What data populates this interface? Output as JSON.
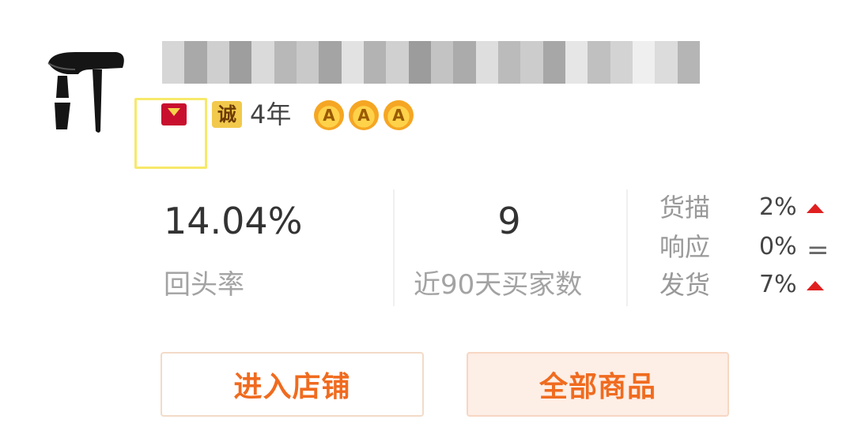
{
  "shop": {
    "logo_icon": "hair-dryer-logo",
    "name": "",
    "name_obscured": true,
    "badges": {
      "tmall_icon": "tmall-badge-icon",
      "cheng_label": "诚",
      "years_label": "4年",
      "crown_count": 3,
      "crown_glyph": "A"
    }
  },
  "stats": {
    "return_rate": {
      "value": "14.04%",
      "label": "回头率"
    },
    "buyers_90d": {
      "value": "9",
      "label": "近90天买家数"
    }
  },
  "ratings": [
    {
      "label": "货描",
      "value": "2%",
      "trend": "up"
    },
    {
      "label": "响应",
      "value": "0%",
      "trend": "equal"
    },
    {
      "label": "发货",
      "value": "7%",
      "trend": "up"
    }
  ],
  "buttons": {
    "enter_shop": "进入店铺",
    "all_products": "全部商品"
  },
  "colors": {
    "accent_orange": "#f06b1f",
    "trend_up_red": "#e02020",
    "badge_gold": "#f2c94c",
    "highlight_yellow": "#f7e96a"
  }
}
